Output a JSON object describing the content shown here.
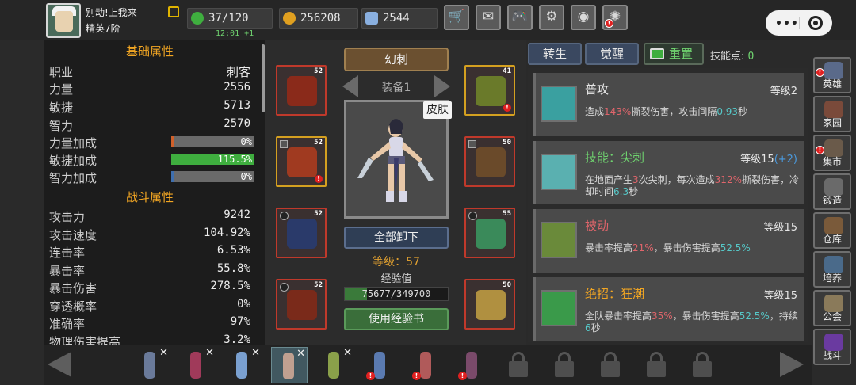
{
  "player": {
    "name": "别动!上我来",
    "rank": "精英7阶",
    "energy": "37/120",
    "energy_timer": "12:01 +1",
    "gold": "256208",
    "gems": "2544"
  },
  "top_buttons": [
    {
      "name": "shop-cart-icon",
      "glyph": "🛒"
    },
    {
      "name": "mail-icon",
      "glyph": "✉"
    },
    {
      "name": "gamepad-icon",
      "glyph": "🎮"
    },
    {
      "name": "gear-icon",
      "glyph": "⚙"
    },
    {
      "name": "color-wheel-icon",
      "glyph": "◉"
    },
    {
      "name": "firework-icon",
      "glyph": "✺"
    }
  ],
  "stats": {
    "basic_title": "基础属性",
    "combat_title": "战斗属性",
    "class_label": "职业",
    "class_value": "刺客",
    "basic": [
      {
        "label": "力量",
        "value": "2556"
      },
      {
        "label": "敏捷",
        "value": "5713"
      },
      {
        "label": "智力",
        "value": "2570"
      }
    ],
    "bonuses": [
      {
        "label": "力量加成",
        "value": "0%",
        "fill": 0.02,
        "color": "#d0602a"
      },
      {
        "label": "敏捷加成",
        "value": "115.5%",
        "fill": 1.0,
        "color": "#3fae3f"
      },
      {
        "label": "智力加成",
        "value": "0%",
        "fill": 0.02,
        "color": "#3f6fae"
      }
    ],
    "combat": [
      {
        "label": "攻击力",
        "value": "9242"
      },
      {
        "label": "攻击速度",
        "value": "104.92%"
      },
      {
        "label": "连击率",
        "value": "6.53%"
      },
      {
        "label": "暴击率",
        "value": "55.8%"
      },
      {
        "label": "暴击伤害",
        "value": "278.5%"
      },
      {
        "label": "穿透概率",
        "value": "0%"
      },
      {
        "label": "准确率",
        "value": "97%"
      },
      {
        "label": "物理伤害提高",
        "value": "3.2%"
      }
    ]
  },
  "equipment": {
    "class_name": "幻刺",
    "set_label": "装备1",
    "skin_label": "皮肤",
    "unequip_all": "全部卸下",
    "level_text": "等级：57",
    "exp_label": "经验值",
    "exp_text": "75677/349700",
    "exp_fraction": 0.216,
    "use_exp_book": "使用经验书",
    "slots": [
      {
        "name": "helmet-slot",
        "level": "52",
        "color": "#8a2a1a",
        "border": "red",
        "lock": "",
        "warn": false
      },
      {
        "name": "armor-slot",
        "level": "52",
        "color": "#a03a20",
        "border": "gold",
        "lock": "square",
        "warn": true
      },
      {
        "name": "pants-slot",
        "level": "52",
        "color": "#2a3a6a",
        "border": "red",
        "lock": "circle",
        "warn": false
      },
      {
        "name": "boots-slot",
        "level": "52",
        "color": "#7a2a1a",
        "border": "red",
        "lock": "circle",
        "warn": false
      },
      {
        "name": "amulet-slot",
        "level": "41",
        "color": "#6a7a2a",
        "border": "gold",
        "lock": "",
        "warn": true
      },
      {
        "name": "bracers-slot",
        "level": "50",
        "color": "#6a4a2a",
        "border": "red",
        "lock": "square",
        "warn": false
      },
      {
        "name": "ring-slot",
        "level": "55",
        "color": "#3a8a5a",
        "border": "red",
        "lock": "circle",
        "warn": false
      },
      {
        "name": "weapon-slot",
        "level": "50",
        "color": "#b09040",
        "border": "red",
        "lock": "",
        "warn": false
      }
    ]
  },
  "skills": {
    "tabs": [
      "转生",
      "觉醒",
      "重置"
    ],
    "points_label": "技能点:",
    "points_value": "0",
    "cards": [
      {
        "name": "普攻",
        "name_color": "#e6e6e6",
        "level": "等级2",
        "level_plus": "",
        "icon_color": "#3aa0a0",
        "desc": [
          {
            "t": "造成"
          },
          {
            "t": "143%",
            "c": "hl-red"
          },
          {
            "t": "撕裂伤害，攻击间隔"
          },
          {
            "t": "0.93",
            "c": "hl-cyan"
          },
          {
            "t": "秒"
          }
        ]
      },
      {
        "name": "技能：尖刺",
        "name_color": "#6fd26f",
        "level": "等级15",
        "level_plus": "(+2)",
        "icon_color": "#5ab0b0",
        "desc": [
          {
            "t": "在地面产生"
          },
          {
            "t": "3",
            "c": "hl-red"
          },
          {
            "t": "次尖刺，每次造成"
          },
          {
            "t": "312%",
            "c": "hl-red"
          },
          {
            "t": "撕裂伤害，冷却时间"
          },
          {
            "t": "6.3",
            "c": "hl-cyan"
          },
          {
            "t": "秒"
          }
        ]
      },
      {
        "name": "被动",
        "name_color": "#e0656b",
        "level": "等级15",
        "level_plus": "",
        "icon_color": "#6a8a3a",
        "desc": [
          {
            "t": "暴击率提高"
          },
          {
            "t": "21%",
            "c": "hl-red"
          },
          {
            "t": "，暴击伤害提高"
          },
          {
            "t": "52.5%",
            "c": "hl-cyan"
          }
        ]
      },
      {
        "name": "绝招：狂潮",
        "name_color": "#f2a623",
        "level": "等级15",
        "level_plus": "",
        "icon_color": "#3a9a4a",
        "desc": [
          {
            "t": "全队暴击率提高"
          },
          {
            "t": "35%",
            "c": "hl-red"
          },
          {
            "t": "，暴击伤害提高"
          },
          {
            "t": "52.5%",
            "c": "hl-cyan"
          },
          {
            "t": "，持续"
          },
          {
            "t": "6",
            "c": "hl-cyan"
          },
          {
            "t": "秒"
          }
        ]
      }
    ]
  },
  "right_nav": [
    {
      "label": "英雄",
      "icon": "hero-icon",
      "color": "#5a6a8a",
      "warn": true
    },
    {
      "label": "家园",
      "icon": "home-icon",
      "color": "#7a4a3a",
      "warn": false
    },
    {
      "label": "集市",
      "icon": "market-icon",
      "color": "#6a5a4a",
      "warn": true
    },
    {
      "label": "锻造",
      "icon": "forge-icon",
      "color": "#6a6a6a",
      "warn": false
    },
    {
      "label": "仓库",
      "icon": "warehouse-icon",
      "color": "#7a5a3a",
      "warn": false
    },
    {
      "label": "培养",
      "icon": "training-icon",
      "color": "#4a6a8a",
      "warn": false
    },
    {
      "label": "公会",
      "icon": "guild-icon",
      "color": "#8a7a5a",
      "warn": false
    },
    {
      "label": "战斗",
      "icon": "battle-portal-icon",
      "color": "#6a3aa0",
      "warn": false
    }
  ],
  "hero_roster": [
    {
      "name": "hero-knight",
      "color": "#6a7a9a",
      "x_mark": "✕",
      "warn": false,
      "active": false
    },
    {
      "name": "hero-mage-red",
      "color": "#a03a5a",
      "x_mark": "✕",
      "warn": false,
      "active": false
    },
    {
      "name": "hero-ice-mage",
      "color": "#7aa0d0",
      "x_mark": "✕",
      "warn": false,
      "active": false
    },
    {
      "name": "hero-assassin",
      "color": "#c0a090",
      "x_mark": "✕",
      "warn": false,
      "active": true
    },
    {
      "name": "hero-archer",
      "color": "#8aa04a",
      "x_mark": "✕",
      "warn": false,
      "active": false
    },
    {
      "name": "hero-gunner",
      "color": "#5a7ab0",
      "x_mark": "",
      "warn": true,
      "active": false
    },
    {
      "name": "hero-rogue",
      "color": "#b05a5a",
      "x_mark": "",
      "warn": true,
      "active": false
    },
    {
      "name": "hero-dark-knight",
      "color": "#7a4a6a",
      "x_mark": "",
      "warn": true,
      "active": false
    }
  ],
  "locked_slots": 5
}
